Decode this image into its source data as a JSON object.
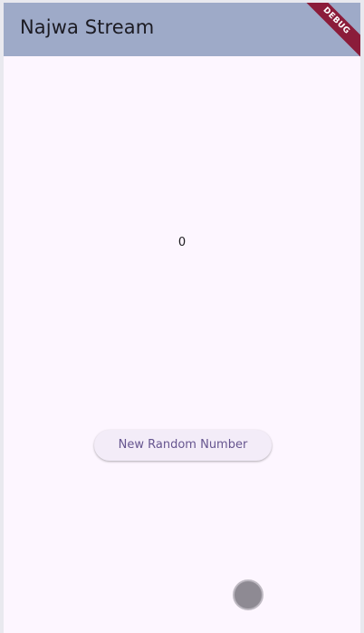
{
  "appbar": {
    "title": "Najwa Stream",
    "background": "#9eaac8"
  },
  "debug_banner": {
    "label": "DEBUG",
    "color": "#8b1c3a"
  },
  "main": {
    "counter_value": "0",
    "button_label": "New Random Number",
    "background": "#fdf6ff",
    "accent": "#66558f"
  }
}
